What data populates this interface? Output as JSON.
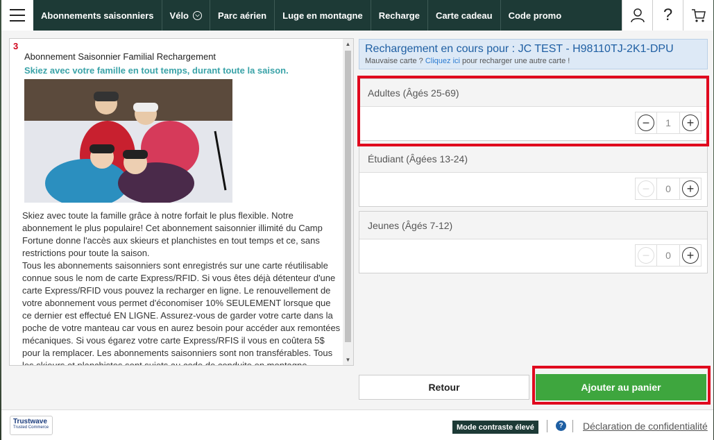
{
  "nav": {
    "items": [
      {
        "label": "Abonnements saisonniers"
      },
      {
        "label": "Vélo",
        "has_dropdown": true
      },
      {
        "label": "Parc aérien"
      },
      {
        "label": "Luge en montagne"
      },
      {
        "label": "Recharge"
      },
      {
        "label": "Carte cadeau"
      },
      {
        "label": "Code promo"
      }
    ],
    "icons": {
      "account": "user-icon",
      "help": "?",
      "cart": "cart-icon"
    }
  },
  "product": {
    "step": "3",
    "title": "Abonnement Saisonnier Familial Rechargement",
    "subtitle": "Skiez avec votre famille en tout temps, durant toute la saison.",
    "description": [
      "Skiez avec toute la famille grâce à notre forfait le plus flexible. Notre abonnement le plus populaire! Cet abonnement saisonnier illimité du Camp Fortune donne l'accès aux skieurs et planchistes en tout temps et ce, sans restrictions pour toute la saison.",
      "Tous les abonnements saisonniers sont enregistrés sur une carte réutilisable connue sous le nom de carte Express/RFID. Si vous êtes déjà détenteur d'une carte Express/RFID vous pouvez la recharger en ligne. Le renouvellement de votre abonnement vous permet d'économiser 10% SEULEMENT lorsque que ce dernier est effectué EN LIGNE. Assurez-vous de garder votre carte dans la poche de votre manteau car vous en aurez besoin pour accéder aux remontées mécaniques. Si vous égarez votre carte Express/RFIS il vous en coûtera 5$ pour la remplacer. Les abonnements saisonniers sont non transférables. Tous les skieurs et planchistes sont sujets au code de conduite en montagne."
    ]
  },
  "reload": {
    "title": "Rechargement en cours pour : JC TEST - H98110TJ-2K1-DPU",
    "sub_prefix": "Mauvaise carte ? ",
    "sub_link": "Cliquez ici",
    "sub_suffix": " pour recharger une autre carte !"
  },
  "quantities": [
    {
      "label": "Adultes (Âgés 25-69)",
      "value": "1",
      "minus_enabled": true
    },
    {
      "label": "Étudiant (Âgées 13-24)",
      "value": "0",
      "minus_enabled": false
    },
    {
      "label": "Jeunes (Âgés 7-12)",
      "value": "0",
      "minus_enabled": false
    }
  ],
  "buttons": {
    "back": "Retour",
    "add_to_cart": "Ajouter au panier"
  },
  "footer": {
    "trust_name": "Trustwave",
    "trust_sub": "Trusted Commerce",
    "contrast": "Mode contraste élevé",
    "help": "?",
    "privacy": "Déclaration de confidentialité"
  },
  "colors": {
    "nav_bg": "#1d3a36",
    "accent_green": "#3ea63e",
    "highlight_red": "#e0081e",
    "link_blue": "#2b7bd1",
    "subtitle_teal": "#3aa3a8"
  }
}
